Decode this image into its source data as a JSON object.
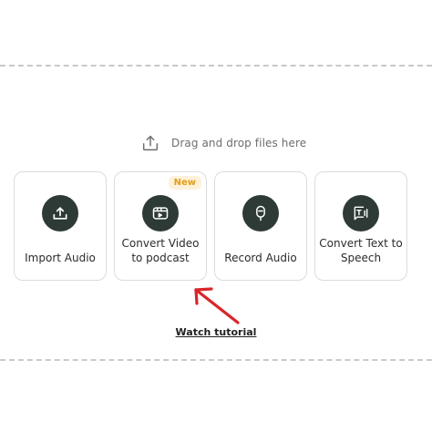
{
  "drop_hint": {
    "text": "Drag and drop files here",
    "icon": "upload-icon"
  },
  "cards": [
    {
      "label": "Import Audio",
      "icon": "upload-icon"
    },
    {
      "label": "Convert Video to podcast",
      "icon": "video-icon",
      "badge": "New"
    },
    {
      "label": "Record Audio",
      "icon": "microphone-icon"
    },
    {
      "label": "Convert Text to Speech",
      "icon": "text-to-speech-icon"
    }
  ],
  "tutorial_link": "Watch tutorial",
  "colors": {
    "icon_bg": "#2e3a36",
    "badge_bg": "#fdf1da",
    "badge_text": "#e39d1b",
    "arrow": "#d9252a"
  }
}
